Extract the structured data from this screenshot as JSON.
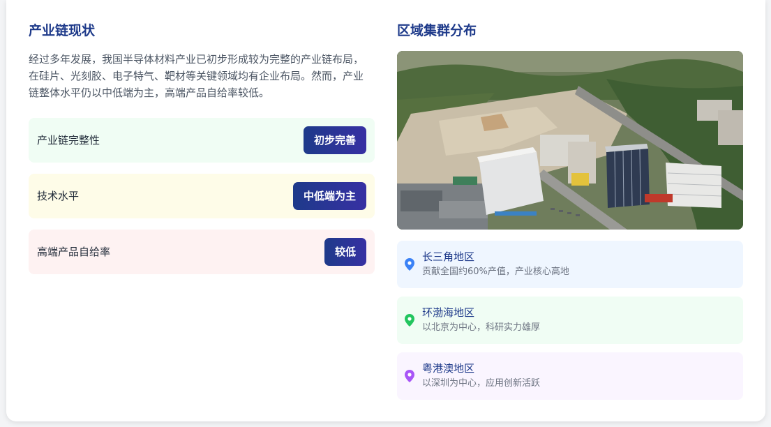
{
  "left": {
    "title": "产业链现状",
    "intro": "经过多年发展，我国半导体材料产业已初步形成较为完整的产业链布局，在硅片、光刻胶、电子特气、靶材等关键领域均有企业布局。然而，产业链整体水平仍以中低端为主，高端产品自给率较低。",
    "stats": [
      {
        "label": "产业链完整性",
        "value": "初步完善",
        "bg": "#f0fdf4"
      },
      {
        "label": "技术水平",
        "value": "中低端为主",
        "bg": "#fefce8"
      },
      {
        "label": "高端产品自给率",
        "value": "较低",
        "bg": "#fef2f2"
      }
    ]
  },
  "right": {
    "title": "区域集群分布",
    "regions": [
      {
        "name": "长三角地区",
        "desc": "贡献全国约60%产值，产业核心高地",
        "icon": "map-pin-icon",
        "pin_color": "#3b82f6",
        "bg": "#eff6ff"
      },
      {
        "name": "环渤海地区",
        "desc": "以北京为中心，科研实力雄厚",
        "icon": "map-pin-icon",
        "pin_color": "#22c55e",
        "bg": "#f0fdf4"
      },
      {
        "name": "粤港澳地区",
        "desc": "以深圳为中心，应用创新活跃",
        "icon": "map-pin-icon",
        "pin_color": "#a855f7",
        "bg": "#faf5ff"
      }
    ]
  },
  "colors": {
    "title": "#1e3a8a",
    "badge_start": "#1e3a8a",
    "badge_end": "#3730a3"
  }
}
